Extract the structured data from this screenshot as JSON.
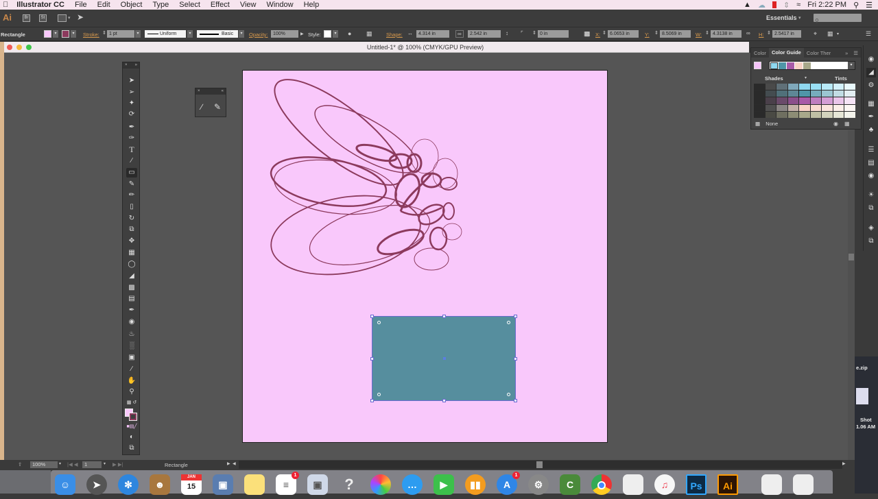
{
  "menubar": {
    "app_name": "Illustrator CC",
    "items": [
      "File",
      "Edit",
      "Object",
      "Type",
      "Select",
      "Effect",
      "View",
      "Window",
      "Help"
    ],
    "clock": "Fri 2:22 PM"
  },
  "appbar": {
    "logo": "Ai",
    "bridge": "Br",
    "stock": "St",
    "workspace": "Essentials",
    "search_placeholder": ""
  },
  "control": {
    "object_type": "Rectangle",
    "fill_color": "#f9c8fb",
    "stroke_color": "#8c3a5d",
    "stroke_label": "Stroke:",
    "stroke_weight": "1 pt",
    "profile": "Uniform",
    "brush": "Basic",
    "opacity_label": "Opacity:",
    "opacity": "100%",
    "style_label": "Style:",
    "shape_label": "Shape:",
    "shape_width": "4.314 in",
    "shape_height": "2.542 in",
    "corner_radius": "0 in",
    "x_label": "X:",
    "x": "6.0653 in",
    "y_label": "Y:",
    "y": "8.5069 in",
    "w_label": "W:",
    "w": "4.3138 in",
    "h_label": "H:",
    "h": "2.5417 in"
  },
  "document": {
    "title": "Untitled-1* @ 100% (CMYK/GPU Preview)",
    "artboard_color": "#f9c8fb",
    "rect_color": "#568e9e",
    "art_stroke": "#8c3a5d"
  },
  "color_guide": {
    "tabs": [
      "Color",
      "Color Guide",
      "Color Ther"
    ],
    "active_tab": "Color Guide",
    "base_color": "#f5c3f9",
    "harmony": [
      "#8fd8f0",
      "#4f95a8",
      "#a85aa8",
      "#f8d2c6",
      "#a8a88a"
    ],
    "shades_label": "Shades",
    "tints_label": "Tints",
    "none_label": "None",
    "grid": [
      [
        "#2a2a2a",
        "#4a4a4a",
        "#607078",
        "#7fa8bb",
        "#8fd8f0",
        "#9ae0f5",
        "#b8eaf8",
        "#d2f1fb",
        "#e9f9fd"
      ],
      [
        "#2a2a2a",
        "#444c50",
        "#50707a",
        "#5e8796",
        "#4f95a8",
        "#77adbd",
        "#9bc6d2",
        "#c1dce4",
        "#e3eef2"
      ],
      [
        "#2a2a2a",
        "#4a404a",
        "#6a4a6a",
        "#8b4f8b",
        "#a85aa8",
        "#bf7ec0",
        "#d49ed5",
        "#eac5ea",
        "#f6e4f6"
      ],
      [
        "#2a2a2a",
        "#505050",
        "#8a8584",
        "#c4b0a8",
        "#f8d2c6",
        "#f9dbd1",
        "#fbe5dd",
        "#fcefe9",
        "#fdf7f4"
      ],
      [
        "#2a2a2a",
        "#4a4a44",
        "#6f6f60",
        "#8d8d75",
        "#a8a88a",
        "#bfbfa4",
        "#d2d2bc",
        "#e6e6d6",
        "#f4f4ec"
      ]
    ],
    "selected_cell": [
      1,
      4
    ]
  },
  "toolbox": {
    "tools": [
      "selection",
      "direct-selection",
      "magic-wand",
      "lasso",
      "pen",
      "curvature",
      "type",
      "line-segment",
      "rectangle",
      "shaper",
      "pencil",
      "eraser",
      "rotate",
      "scale",
      "puppet-warp",
      "free-transform",
      "shape-builder",
      "perspective-grid",
      "mesh",
      "gradient",
      "eyedropper",
      "blend",
      "symbol-sprayer",
      "column-graph",
      "artboard",
      "slice",
      "hand",
      "zoom"
    ],
    "active_tool": "rectangle"
  },
  "statusbar": {
    "zoom": "100%",
    "artboard_num": "1",
    "current_tool": "Rectangle"
  },
  "dock": {
    "apps": [
      "Finder",
      "Launchpad",
      "Safari",
      "Contacts",
      "Calendar",
      "Preview",
      "Notes",
      "Reminders",
      "Photo Booth",
      "Help",
      "Photos",
      "Messages",
      "FaceTime",
      "iBooks",
      "App Store",
      "System Preferences",
      "Camtasia",
      "Chrome",
      "TextEdit",
      "iTunes",
      "Photoshop",
      "Illustrator",
      "Downloads",
      "Trash"
    ],
    "calendar_month": "JAN",
    "calendar_day": "15",
    "reminders_badge": "1",
    "appstore_badge": "1"
  },
  "desktop": {
    "file1": "e.zip",
    "file2_line1": "Shot",
    "file2_line2": "1.06 AM"
  }
}
